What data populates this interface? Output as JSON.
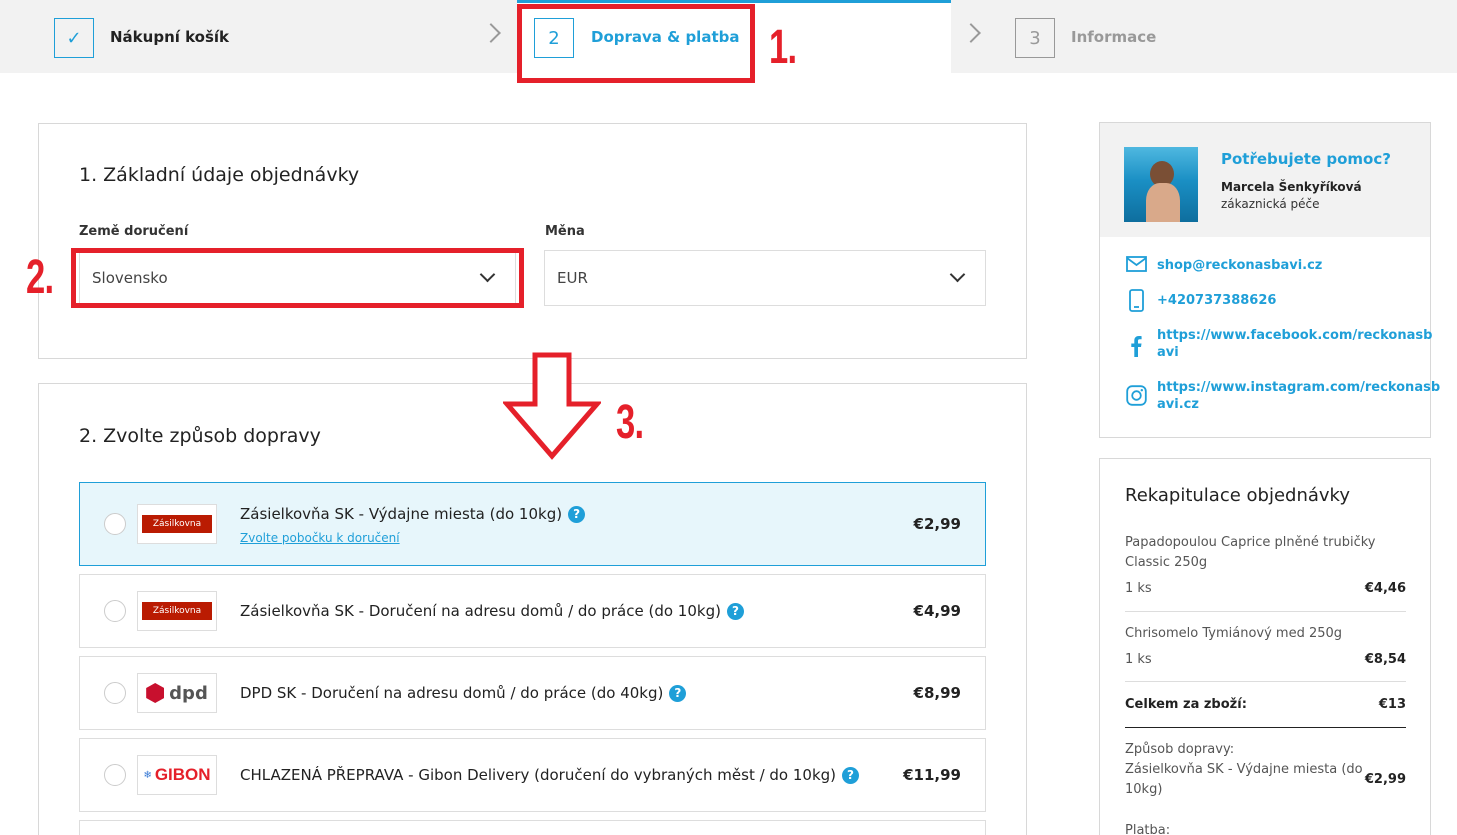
{
  "steps": [
    {
      "num": "✓",
      "label": "Nákupní košík"
    },
    {
      "num": "2",
      "label": "Doprava & platba"
    },
    {
      "num": "3",
      "label": "Informace"
    }
  ],
  "annotations": {
    "a1": "1.",
    "a2": "2.",
    "a3": "3."
  },
  "section1": {
    "title": "1. Základní údaje objednávky",
    "country_label": "Země doručení",
    "country_value": "Slovensko",
    "currency_label": "Měna",
    "currency_value": "EUR"
  },
  "section2": {
    "title": "2. Zvolte způsob dopravy",
    "options": [
      {
        "name": "Zásielkovňa SK - Výdajne miesta (do 10kg)",
        "price": "€2,99",
        "link": "Zvolte pobočku k doručení",
        "logo": "Zásilkovna"
      },
      {
        "name": "Zásielkovňa SK - Doručení na adresu domů / do práce (do 10kg)",
        "price": "€4,99",
        "logo": "Zásilkovna"
      },
      {
        "name": "DPD SK - Doručení na adresu domů / do práce (do 40kg)",
        "price": "€8,99",
        "logo": "dpd"
      },
      {
        "name": "CHLAZENÁ PŘEPRAVA - Gibon Delivery (doručení do vybraných měst / do 10kg)",
        "price": "€11,99",
        "logo": "GIBON"
      }
    ]
  },
  "help": {
    "title": "Potřebujete pomoc?",
    "person": "Marcela Šenkyříková",
    "role": "zákaznická péče",
    "email": "shop@reckonasbavi.cz",
    "phone": "+420737388626",
    "facebook_l1": "https://www.facebook.com/reckonasb",
    "facebook_l2": "avi",
    "instagram_l1": "https://www.instagram.com/reckonasb",
    "instagram_l2": "avi.cz"
  },
  "summary": {
    "title": "Rekapitulace objednávky",
    "items": [
      {
        "name_l1": "Papadopoulou Caprice plněné trubičky",
        "name_l2": "Classic 250g",
        "qty": "1 ks",
        "price": "€4,46"
      },
      {
        "name_l1": "Chrisomelo Tymiánový med 250g",
        "qty": "1 ks",
        "price": "€8,54"
      }
    ],
    "total_label": "Celkem za zboží:",
    "total_value": "€13",
    "shipping_label": "Způsob dopravy:",
    "shipping_l1": "Zásielkovňa SK - Výdajne miesta (do",
    "shipping_l2": "10kg)",
    "shipping_price": "€2,99",
    "payment_label": "Platba:"
  },
  "colors": {
    "accent": "#1f9fd8",
    "annotation": "#e5202a"
  }
}
